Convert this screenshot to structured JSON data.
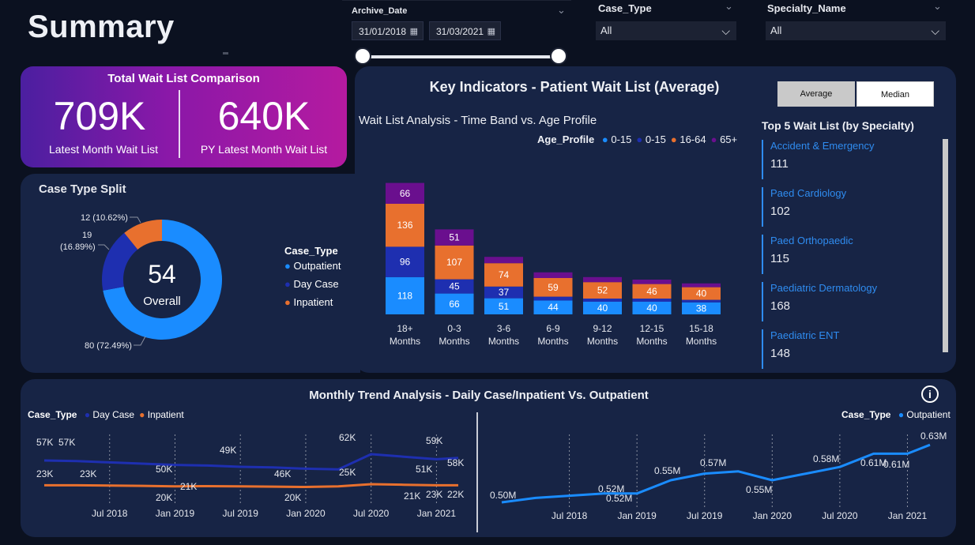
{
  "page": {
    "title": "Summary"
  },
  "slicers": {
    "archive_date": {
      "label": "Archive_Date",
      "start": "31/01/2018",
      "end": "31/03/2021"
    },
    "case_type": {
      "label": "Case_Type",
      "value": "All"
    },
    "specialty": {
      "label": "Specialty_Name",
      "value": "All"
    }
  },
  "kpi": {
    "title": "Total Wait List Comparison",
    "latest_value": "709K",
    "latest_label": "Latest Month Wait List",
    "py_value": "640K",
    "py_label": "PY Latest Month Wait List"
  },
  "key_indicators": {
    "title": "Key Indicators - Patient Wait List (Average)",
    "toggle_average": "Average",
    "toggle_median": "Median",
    "toggle_selected": "Average"
  },
  "case_split": {
    "title": "Case Type Split",
    "center_value": "54",
    "center_label": "Overall",
    "legend_title": "Case_Type",
    "legend": [
      {
        "name": "Outpatient",
        "color": "#1a8cff"
      },
      {
        "name": "Day Case",
        "color": "#1e2fb0"
      },
      {
        "name": "Inpatient",
        "color": "#e8702e"
      }
    ],
    "chart_data": {
      "type": "pie",
      "categories": [
        "Outpatient",
        "Day Case",
        "Inpatient"
      ],
      "values": [
        80,
        19,
        12
      ],
      "labels": [
        "80 (72.49%)",
        "19 (16.89%)",
        "12 (10.62%)"
      ]
    }
  },
  "wait_list": {
    "title": "Wait List Analysis - Time Band vs. Age Profile",
    "legend_title": "Age_Profile",
    "legend_colors": [
      "#1a8cff",
      "#1e2fb0",
      "#e8702e",
      "#6a0f8e"
    ],
    "chart_data": {
      "type": "bar",
      "stacked": true,
      "categories": [
        "18+ Months",
        "0-3 Months",
        "3-6 Months",
        "6-9 Months",
        "9-12 Months",
        "12-15 Months",
        "15-18 Months"
      ],
      "series": [
        {
          "name": "0-15",
          "color": "#1a8cff",
          "values": [
            118,
            66,
            51,
            44,
            40,
            40,
            38
          ]
        },
        {
          "name": "0-15",
          "color": "#1e2fb0",
          "values": [
            96,
            45,
            37,
            12,
            10,
            10,
            8
          ]
        },
        {
          "name": "16-64",
          "color": "#e8702e",
          "values": [
            136,
            107,
            74,
            59,
            52,
            46,
            40
          ]
        },
        {
          "name": "65+",
          "color": "#6a0f8e",
          "values": [
            66,
            51,
            20,
            18,
            16,
            14,
            12
          ]
        }
      ],
      "data_labels": [
        [
          "118",
          "96",
          "136",
          "66"
        ],
        [
          "66",
          "45",
          "107",
          "51"
        ],
        [
          "51",
          "37",
          "74",
          ""
        ],
        [
          "44",
          "",
          "59",
          ""
        ],
        [
          "40",
          "",
          "52",
          ""
        ],
        [
          "40",
          "",
          "46",
          ""
        ],
        [
          "38",
          "",
          "40",
          ""
        ]
      ]
    }
  },
  "top5": {
    "title": "Top 5 Wait List (by Specialty)",
    "items": [
      {
        "name": "Accident & Emergency",
        "value": "111"
      },
      {
        "name": "Paed Cardiology",
        "value": "102"
      },
      {
        "name": "Paed Orthopaedic",
        "value": "115"
      },
      {
        "name": "Paediatric Dermatology",
        "value": "168"
      },
      {
        "name": "Paediatric ENT",
        "value": "148"
      }
    ]
  },
  "trend": {
    "title": "Monthly Trend Analysis - Daily Case/Inpatient Vs. Outpatient",
    "left_legend_title": "Case_Type",
    "left_legend": [
      {
        "name": "Day Case",
        "color": "#1e2fb0"
      },
      {
        "name": "Inpatient",
        "color": "#e8702e"
      }
    ],
    "right_legend_title": "Case_Type",
    "right_legend": [
      {
        "name": "Outpatient",
        "color": "#1a8cff"
      }
    ],
    "x_ticks": [
      "Jul 2018",
      "Jan 2019",
      "Jul 2019",
      "Jan 2020",
      "Jul 2020",
      "Jan 2021"
    ],
    "chart_data": [
      {
        "type": "line",
        "x": [
          "Jan 2018",
          "Apr 2018",
          "Jul 2018",
          "Oct 2018",
          "Jan 2019",
          "Apr 2019",
          "Jul 2019",
          "Oct 2019",
          "Jan 2020",
          "Apr 2020",
          "Jul 2020",
          "Oct 2020",
          "Jan 2021",
          "Mar 2021"
        ],
        "series": [
          {
            "name": "Day Case",
            "color": "#1e2fb0",
            "values": [
              57,
              56.5,
              55.5,
              54.5,
              53.5,
              53,
              52,
              51.5,
              50.5,
              50,
              62,
              60,
              58,
              59
            ],
            "labels": [
              [
                "Jan 2018",
                "57K"
              ],
              [
                "Apr 2018",
                "57K"
              ],
              [
                "Jan 2019",
                "50K"
              ],
              [
                "Jul 2019",
                "49K"
              ],
              [
                "Jan 2020",
                "46K"
              ],
              [
                "Jul 2020",
                "62K"
              ],
              [
                "Jan 2021",
                "51K"
              ],
              [
                "Jan 2021",
                "59K"
              ],
              [
                "Mar 2021",
                "58K"
              ]
            ]
          },
          {
            "name": "Inpatient",
            "color": "#e8702e",
            "values": [
              23,
              23,
              22.5,
              22,
              21,
              21.5,
              21,
              20.5,
              20,
              21,
              25,
              24,
              23,
              23
            ],
            "labels": [
              [
                "Jan 2018",
                "23K"
              ],
              [
                "Jul 2018",
                "23K"
              ],
              [
                "Jan 2019",
                "20K"
              ],
              [
                "Apr 2019",
                "21K"
              ],
              [
                "Jan 2020",
                "20K"
              ],
              [
                "Jul 2020",
                "25K"
              ],
              [
                "Jan 2021",
                "21K"
              ],
              [
                "Jan 2021",
                "23K"
              ],
              [
                "Mar 2021",
                "22K"
              ]
            ]
          }
        ]
      },
      {
        "type": "line",
        "x": [
          "Jan 2018",
          "Apr 2018",
          "Jul 2018",
          "Oct 2018",
          "Jan 2019",
          "Apr 2019",
          "Jul 2019",
          "Oct 2019",
          "Jan 2020",
          "Apr 2020",
          "Jul 2020",
          "Oct 2020",
          "Jan 2021",
          "Mar 2021"
        ],
        "series": [
          {
            "name": "Outpatient",
            "color": "#1a8cff",
            "values": [
              0.5,
              0.51,
              0.515,
              0.52,
              0.52,
              0.55,
              0.565,
              0.57,
              0.55,
              0.565,
              0.58,
              0.61,
              0.61,
              0.63
            ],
            "labels": [
              [
                "Jan 2018",
                "0.50M"
              ],
              [
                "Jan 2019",
                "0.52M"
              ],
              [
                "Jan 2019",
                "0.52M"
              ],
              [
                "Apr 2019",
                "0.55M"
              ],
              [
                "Oct 2019",
                "0.57M"
              ],
              [
                "Jan 2020",
                "0.55M"
              ],
              [
                "Jul 2020",
                "0.58M"
              ],
              [
                "Oct 2020",
                "0.61M"
              ],
              [
                "Jan 2021",
                "0.61M"
              ],
              [
                "Mar 2021",
                "0.63M"
              ]
            ]
          }
        ]
      }
    ]
  }
}
